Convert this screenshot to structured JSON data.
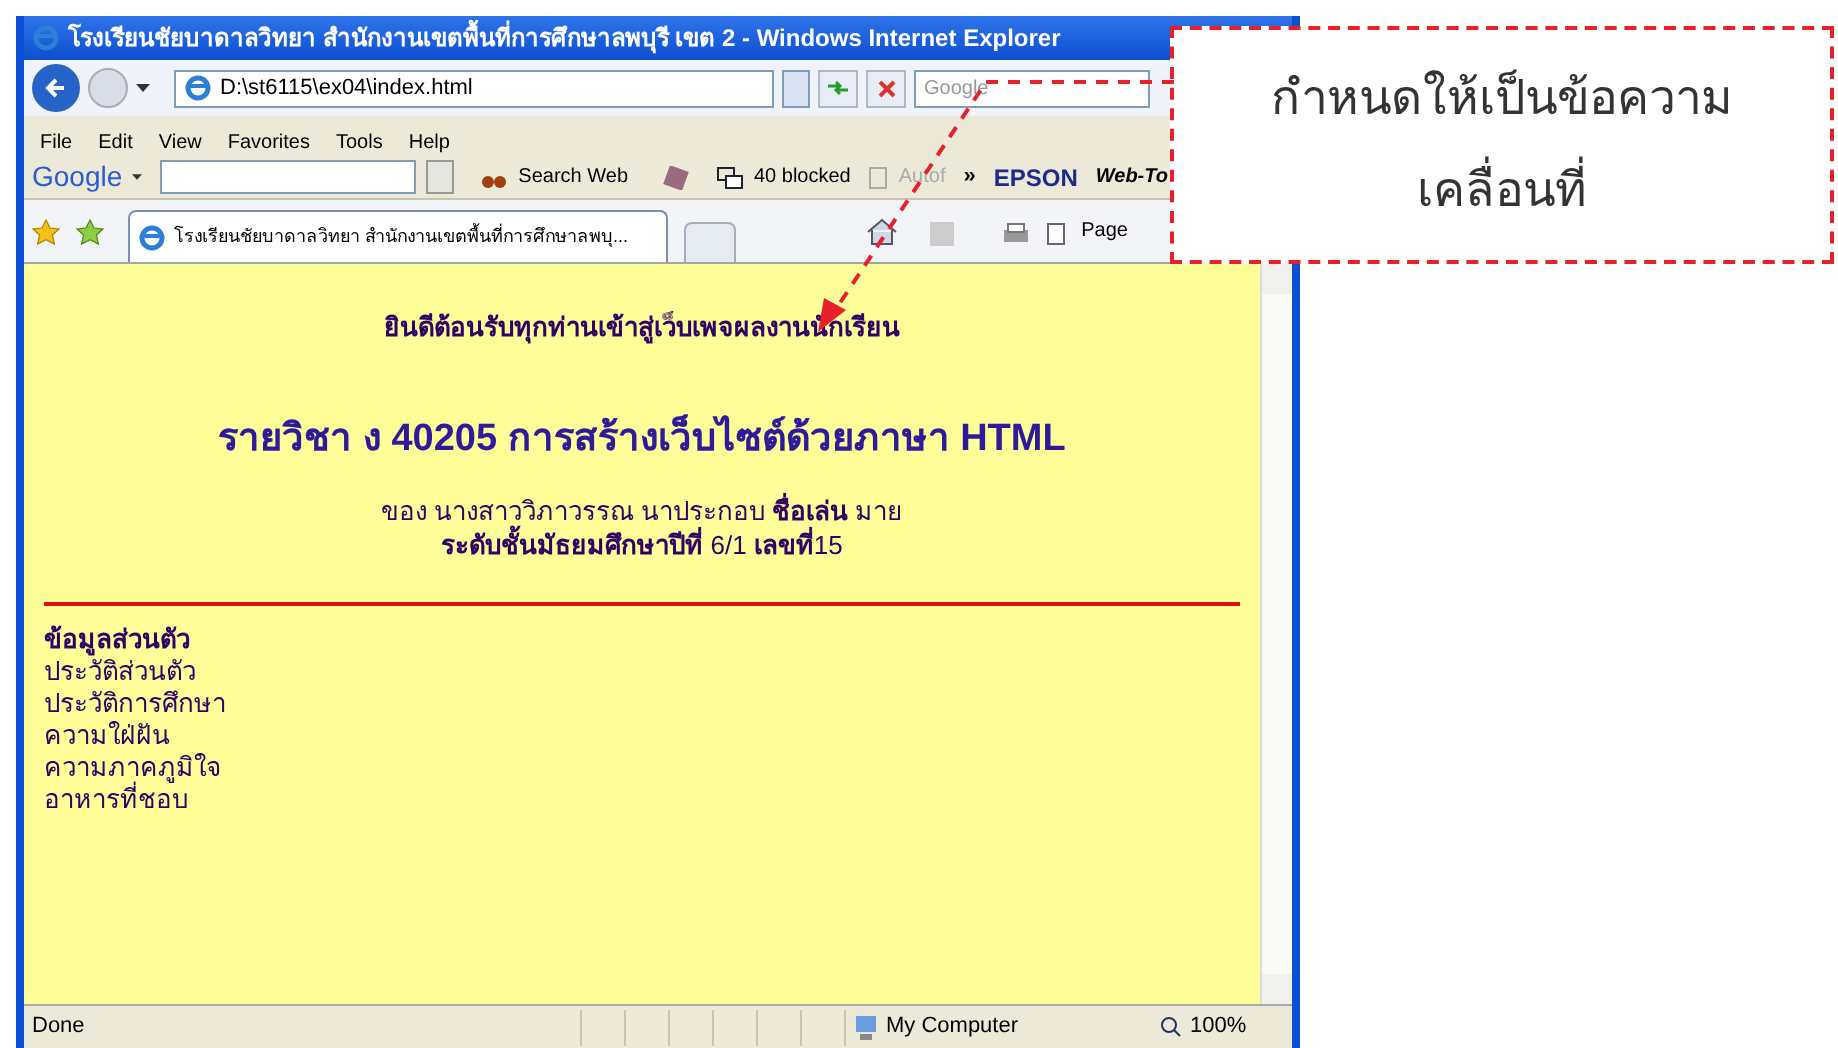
{
  "window": {
    "title": "โรงเรียนชัยบาดาลวิทยา สำนักงานเขตพื้นที่การศึกษาลพบุรี เขต 2 - Windows Internet Explorer"
  },
  "address_bar": {
    "value": "D:\\st6115\\ex04\\index.html",
    "search_placeholder": "Google"
  },
  "menu": [
    "File",
    "Edit",
    "View",
    "Favorites",
    "Tools",
    "Help"
  ],
  "google_toolbar": {
    "logo": "Google",
    "search": "Search Web",
    "blocked": "40 blocked",
    "autofill": "Autof",
    "more": "»",
    "epson": "EPSON",
    "web_to": "Web-To"
  },
  "tab": {
    "title": "โรงเรียนชัยบาดาลวิทยา สำนักงานเขตพื้นที่การศึกษาลพบุ...",
    "selected": true
  },
  "command_bar": {
    "page": "Page"
  },
  "page": {
    "welcome": "ยินดีต้อนรับทุกท่านเข้าสู่เว็บเพจผลงานนักเรียน",
    "heading": "รายวิชา ง 40205 การสร้างเว็บไซต์ด้วยภาษา HTML",
    "author": "ของ นางสาววิภาวรรณ นาประกอบ **ชื่อเล่น** มาย",
    "class_line": "**ระดับชั้นมัธยมศึกษาปีที่** 6/1 **เลขที่**15",
    "menu_heading": "ข้อมูลส่วนตัว",
    "menu_items": [
      "ประวัติส่วนตัว",
      "ประวัติการศึกษา",
      "ความใฝ่ฝัน",
      "ความภาคภูมิใจ",
      "อาหารที่ชอบ"
    ]
  },
  "status_bar": {
    "text": "Done",
    "zone": "My Computer",
    "zoom": "100%"
  },
  "callout": {
    "lines": [
      "กำหนดให้เป็นข้อความ",
      "เคลื่อนที่"
    ]
  }
}
